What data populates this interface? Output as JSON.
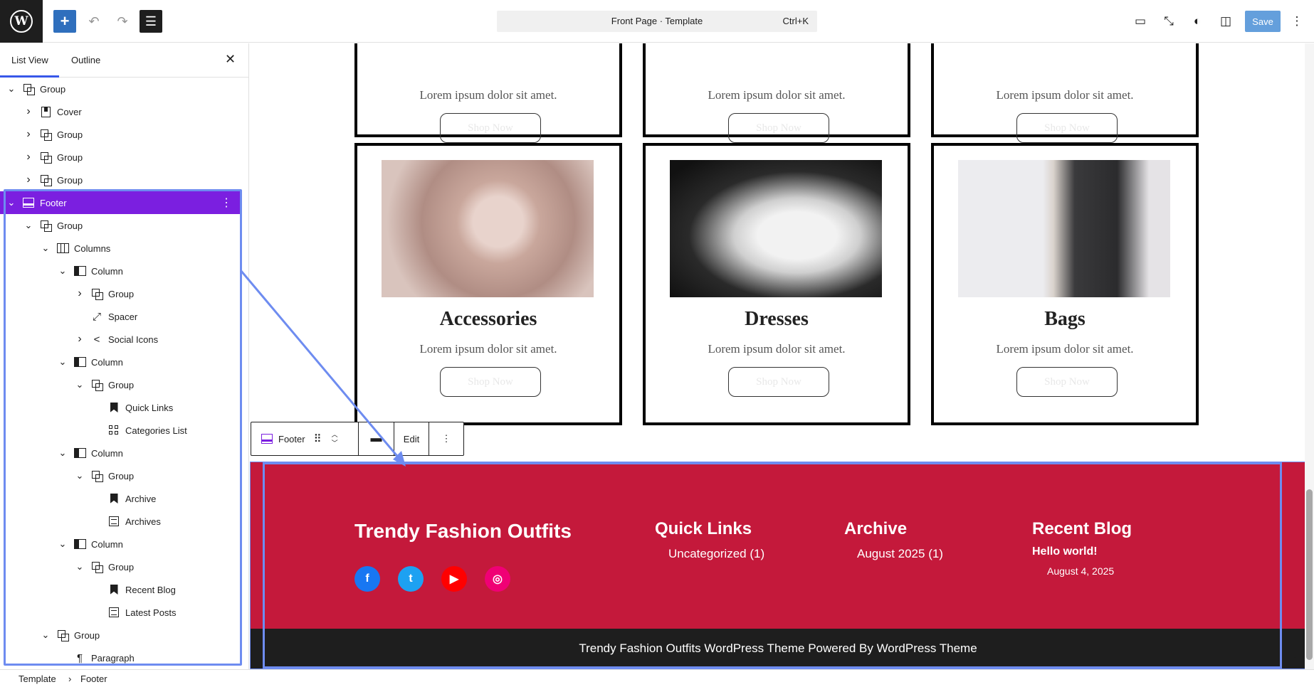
{
  "topbar": {
    "logo_letter": "W",
    "add_icon": "plus-icon",
    "undo_icon": "undo-icon",
    "redo_icon": "redo-icon",
    "document_overview_icon": "list-view-icon",
    "command_title": "Front Page · Template",
    "command_shortcut": "Ctrl+K",
    "view_icon": "desktop-icon",
    "fullscreen_icon": "external-icon",
    "styles_icon": "contrast-icon",
    "settings_icon": "sidebar-icon",
    "save_label": "Save",
    "options_icon": "more-vertical-icon"
  },
  "sidebar": {
    "tabs": [
      {
        "label": "List View"
      },
      {
        "label": "Outline"
      }
    ],
    "close_icon": "close-icon",
    "tree": [
      {
        "label": "Group",
        "icon": "group",
        "depth": 0,
        "expand": "open"
      },
      {
        "label": "Cover",
        "icon": "cover",
        "depth": 1,
        "expand": "closed"
      },
      {
        "label": "Group",
        "icon": "group",
        "depth": 1,
        "expand": "closed"
      },
      {
        "label": "Group",
        "icon": "group",
        "depth": 1,
        "expand": "closed"
      },
      {
        "label": "Group",
        "icon": "group",
        "depth": 1,
        "expand": "closed"
      },
      {
        "label": "Footer",
        "icon": "footer",
        "depth": 0,
        "expand": "open",
        "selected": true
      },
      {
        "label": "Group",
        "icon": "group",
        "depth": 1,
        "expand": "open"
      },
      {
        "label": "Columns",
        "icon": "columns",
        "depth": 2,
        "expand": "open"
      },
      {
        "label": "Column",
        "icon": "column",
        "depth": 3,
        "expand": "open"
      },
      {
        "label": "Group",
        "icon": "group",
        "depth": 4,
        "expand": "closed"
      },
      {
        "label": "Spacer",
        "icon": "spacer",
        "depth": 4,
        "expand": "none"
      },
      {
        "label": "Social Icons",
        "icon": "share",
        "depth": 4,
        "expand": "closed"
      },
      {
        "label": "Column",
        "icon": "column",
        "depth": 3,
        "expand": "open"
      },
      {
        "label": "Group",
        "icon": "group",
        "depth": 4,
        "expand": "open"
      },
      {
        "label": "Quick Links",
        "icon": "bookmark",
        "depth": 5,
        "expand": "none"
      },
      {
        "label": "Categories List",
        "icon": "grid",
        "depth": 5,
        "expand": "none"
      },
      {
        "label": "Column",
        "icon": "column",
        "depth": 3,
        "expand": "open"
      },
      {
        "label": "Group",
        "icon": "group",
        "depth": 4,
        "expand": "open"
      },
      {
        "label": "Archive",
        "icon": "bookmark",
        "depth": 5,
        "expand": "none"
      },
      {
        "label": "Archives",
        "icon": "archives",
        "depth": 5,
        "expand": "none"
      },
      {
        "label": "Column",
        "icon": "column",
        "depth": 3,
        "expand": "open"
      },
      {
        "label": "Group",
        "icon": "group",
        "depth": 4,
        "expand": "open"
      },
      {
        "label": "Recent Blog",
        "icon": "bookmark",
        "depth": 5,
        "expand": "none"
      },
      {
        "label": "Latest Posts",
        "icon": "archives",
        "depth": 5,
        "expand": "none"
      },
      {
        "label": "Group",
        "icon": "group",
        "depth": 2,
        "expand": "open"
      },
      {
        "label": "Paragraph",
        "icon": "paragraph",
        "depth": 3,
        "expand": "none"
      }
    ]
  },
  "canvas": {
    "top_cards": [
      {
        "text": "Lorem ipsum dolor sit amet.",
        "button": "Shop Now"
      },
      {
        "text": "Lorem ipsum dolor sit amet.",
        "button": "Shop Now"
      },
      {
        "text": "Lorem ipsum dolor sit amet.",
        "button": "Shop Now"
      }
    ],
    "cards": [
      {
        "title": "Accessories",
        "text": "Lorem ipsum dolor sit amet.",
        "button": "Shop Now"
      },
      {
        "title": "Dresses",
        "text": "Lorem ipsum dolor sit amet.",
        "button": "Shop Now"
      },
      {
        "title": "Bags",
        "text": "Lorem ipsum dolor sit amet.",
        "button": "Shop Now"
      }
    ]
  },
  "block_toolbar": {
    "block_label": "Footer",
    "edit_label": "Edit"
  },
  "footer": {
    "site_title": "Trendy Fashion Outfits",
    "quick_links_title": "Quick Links",
    "quick_links_item": "Uncategorized (1)",
    "archive_title": "Archive",
    "archive_item": "August 2025 (1)",
    "recent_title": "Recent Blog",
    "recent_post": "Hello world!",
    "recent_date": "August 4, 2025",
    "copyright": "Trendy Fashion Outfits WordPress Theme Powered By WordPress Theme",
    "social": [
      {
        "name": "facebook-icon",
        "color": "#1877f2",
        "glyph": "f"
      },
      {
        "name": "twitter-icon",
        "color": "#1da1f2",
        "glyph": "t"
      },
      {
        "name": "youtube-icon",
        "color": "#ff0000",
        "glyph": "▶"
      },
      {
        "name": "instagram-icon",
        "color": "#f00075",
        "glyph": "◎"
      }
    ]
  },
  "breadcrumb": {
    "items": [
      "Template",
      "Footer"
    ]
  },
  "colors": {
    "accent": "#3858e9",
    "selected": "#7b1fe0",
    "footer_red": "#c4193b",
    "footer_dark": "#1e1e1e"
  }
}
